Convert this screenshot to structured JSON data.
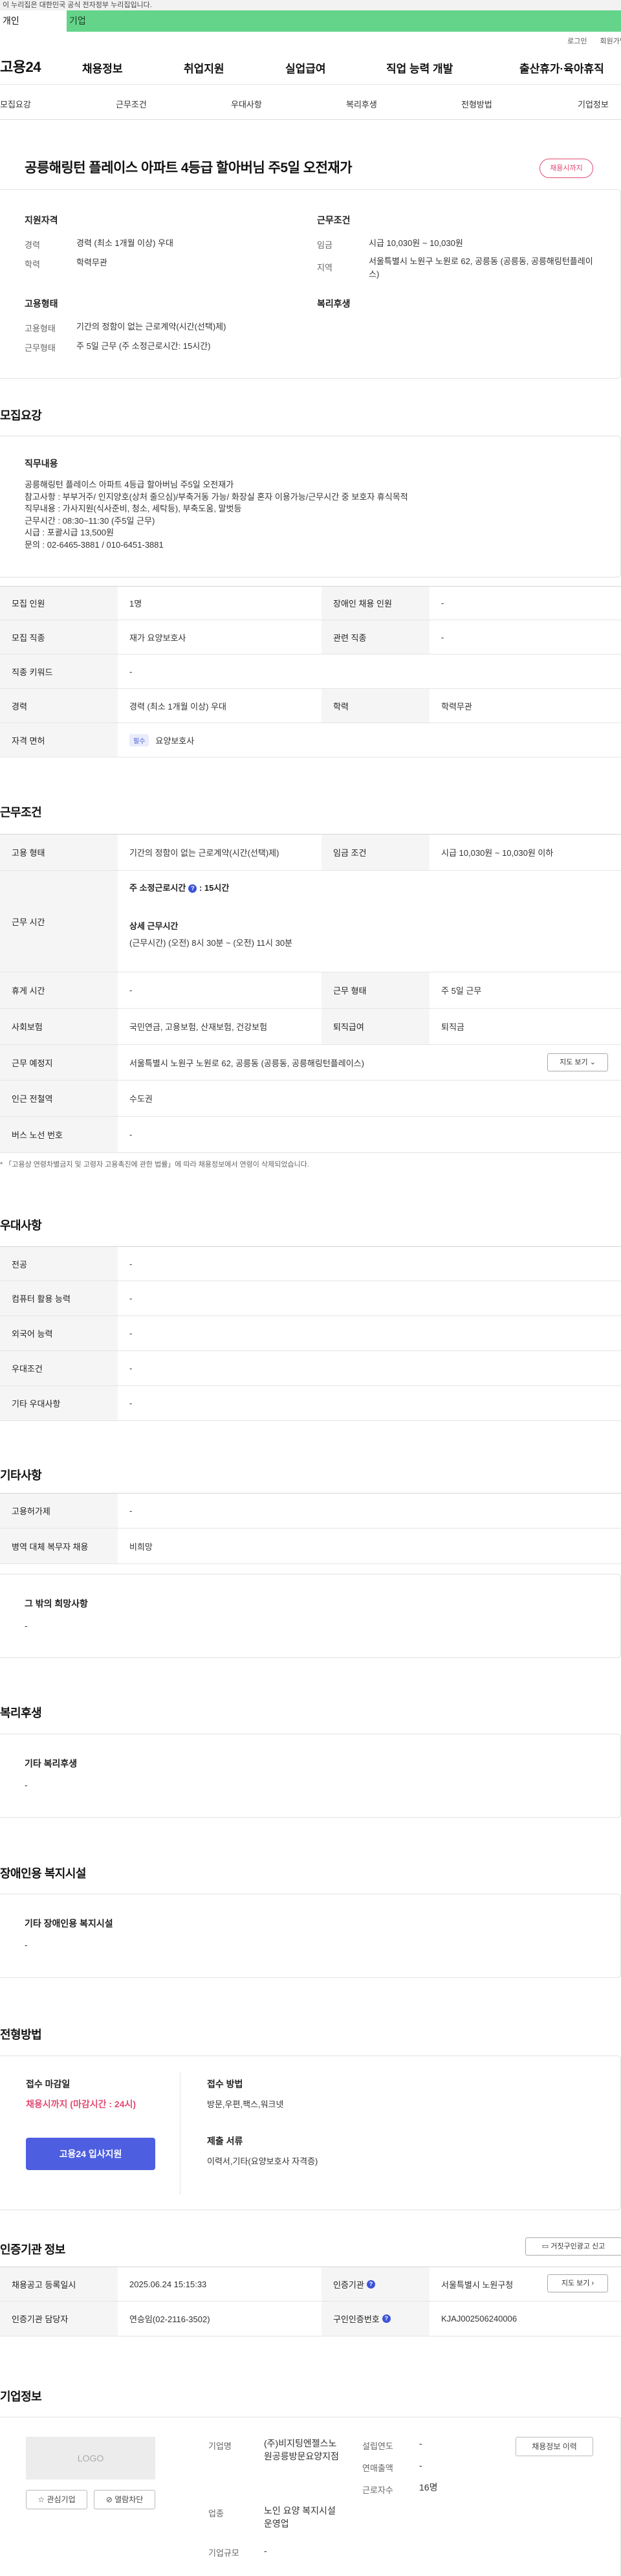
{
  "gov_banner": "이 누리집은 대한민국 공식 전자정부 누리집입니다.",
  "persona_tabs": [
    "개인",
    "기업"
  ],
  "util_links": [
    "로그인",
    "회원가입"
  ],
  "logo": "고용24",
  "gnb": [
    "채용정보",
    "취업지원",
    "실업급여",
    "직업 능력 개발",
    "출산휴가·육아휴직"
  ],
  "anchor_nav": [
    "모집요강",
    "근무조건",
    "우대사항",
    "복리후생",
    "전형방법",
    "기업정보"
  ],
  "summary": {
    "title": "공릉해링턴 플레이스 아파트 4등급 할아버님 주5일 오전재가",
    "badge": "채용시까지",
    "support_head": "지원자격",
    "career_label": "경력",
    "career_value": "경력 (최소 1개월 이상) 우대",
    "edu_label": "학력",
    "edu_value": "학력무관",
    "conditions_head": "근무조건",
    "wage_label": "임금",
    "wage_value": "시급 10,030원 ~ 10,030원",
    "area_label": "지역",
    "area_value": "서울특별시 노원구 노원로 62, 공릉동 (공릉동, 공릉해링턴플레이스)",
    "emp_head": "고용형태",
    "emp_type_label": "고용형태",
    "emp_type_value": "기간의 정함이 없는 근로계약(시간(선택)제)",
    "work_form_label": "근무형태",
    "work_form_value": "주 5일 근무 (주 소정근로시간: 15시간)",
    "welfare_head": "복리후생"
  },
  "recruit": {
    "section": "모집요강",
    "duty_head": "직무내용",
    "duty_body": "공릉해링턴 플레이스 아파트 4등급 할아버님 주5일 오전재가\n참고사항 : 부부거주/ 인지양호(상처 줄으심)/부축거동 가능/ 화장실 혼자 이용가능/근무시간 중 보호자 휴식목적\n직무내용 : 가사지원(식사준비, 청소, 세탁등), 부축도움, 말벗등\n근무시간 : 08:30~11:30 (주5일 근무)\n시급 : 포괄시급 13,500원\n문의 : 02-6465-3881 / 010-6451-3881",
    "rows": [
      {
        "label1": "모집 인원",
        "value1": "1명",
        "label2": "장애인 채용 인원",
        "value2": "-"
      },
      {
        "label1": "모집 직종",
        "value1": "재가 요양보호사",
        "label2": "관련 직종",
        "value2": "-"
      },
      {
        "label1": "직종 키워드",
        "value1": "-"
      },
      {
        "label1": "경력",
        "value1": "경력 (최소 1개월 이상) 우대",
        "label2": "학력",
        "value2": "학력무관"
      },
      {
        "label1": "자격 면허",
        "chip": "필수",
        "value1": "요양보호사"
      }
    ]
  },
  "conditions": {
    "section": "근무조건",
    "emp_type_label": "고용 형태",
    "emp_type_value": "기간의 정함이 없는 근로계약(시간(선택)제)",
    "wage_label": "임금 조건",
    "wage_value": "시급 10,030원 ~ 10,030원 이하",
    "hours_label": "근무 시간",
    "weekly_hours_title": "주 소정근로시간",
    "weekly_hours_value": ": 15시간",
    "detail_title": "상세 근무시간",
    "detail_value": "(근무시간) (오전) 8시 30분 ~ (오전) 11시 30분",
    "break_label": "휴게 시간",
    "break_value": "-",
    "work_form_label": "근무 형태",
    "work_form_value": "주 5일 근무",
    "insurance_label": "사회보험",
    "insurance_value": "국민연금, 고용보험, 산재보험, 건강보험",
    "severance_label": "퇴직급여",
    "severance_value": "퇴직금",
    "location_label": "근무 예정지",
    "location_value": "서울특별시 노원구 노원로 62, 공릉동 (공릉동, 공릉해링턴플레이스)",
    "map_button": "지도 보기",
    "subway_label": "인근 전철역",
    "subway_value": "수도권",
    "bus_label": "버스 노선 번호",
    "bus_value": "-",
    "note": "* 「고용상 연령차별금지 및 고령자 고용촉진에 관한 법률」에 따라 채용정보에서 연령이 삭제되었습니다."
  },
  "preference": {
    "section": "우대사항",
    "rows": [
      {
        "label": "전공",
        "value": "-"
      },
      {
        "label": "컴퓨터 활용 능력",
        "value": "-"
      },
      {
        "label": "외국어 능력",
        "value": "-"
      },
      {
        "label": "우대조건",
        "value": "-"
      },
      {
        "label": "기타 우대사항",
        "value": "-"
      }
    ]
  },
  "etc": {
    "section": "기타사항",
    "rows": [
      {
        "label": "고용허가제",
        "value": "-"
      },
      {
        "label": "병역 대체 복무자 채용",
        "value": "비희망"
      }
    ],
    "other_head": "그 밖의 희망사항",
    "other_value": "-"
  },
  "welfare": {
    "section": "복리후생",
    "head": "기타 복리후생",
    "value": "-"
  },
  "disability": {
    "section": "장애인용 복지시설",
    "head": "기타 장애인용 복지시설",
    "value": "-"
  },
  "apply": {
    "section": "전형방법",
    "deadline_head": "접수 마감일",
    "deadline_value": "채용시까지 (마감시간 : 24시)",
    "apply_button": "고용24 입사지원",
    "method_head": "접수 방법",
    "method_value": "방문,우편,팩스,워크넷",
    "docs_head": "제출 서류",
    "docs_value": "이력서,기타(요양보호사 자격증)"
  },
  "cert": {
    "section": "인증기관 정보",
    "report_button": "거짓구인광고 신고",
    "reg_date_label": "채용공고 등록일시",
    "reg_date_value": "2025.06.24 15:15:33",
    "agency_label": "인증기관",
    "agency_value": "서울특별시 노원구청",
    "map_button": "지도 보기",
    "manager_label": "인증기관 담당자",
    "manager_value": "연승임(02-2116-3502)",
    "job_no_label": "구인인증번호",
    "job_no_value": "KJAJ002506240006"
  },
  "company": {
    "section": "기업정보",
    "logo_text": "LOGO",
    "interest_button": "관심기업",
    "block_button": "열람차단",
    "name_label": "기업명",
    "name_value": "(주)비지팅엔젤스노원공릉방문요양지점",
    "industry_label": "업종",
    "industry_value": "노인 요양 복지시설 운영업",
    "scale_label": "기업규모",
    "scale_value": "-",
    "founded_label": "설립연도",
    "founded_value": "-",
    "sales_label": "연매출액",
    "sales_value": "-",
    "employees_label": "근로자수",
    "employees_value": "16명",
    "jobs_button": "채용정보 이력"
  }
}
